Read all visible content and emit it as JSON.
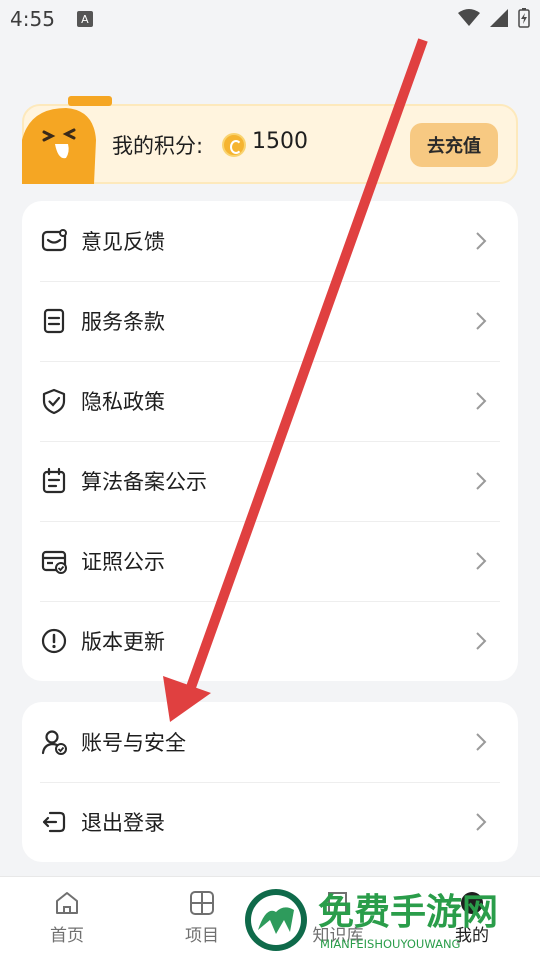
{
  "status_bar": {
    "time": "4:55",
    "notification_icon": "a-icon"
  },
  "points_card": {
    "label": "我的积分:",
    "value": "1500",
    "recharge_button": "去充值"
  },
  "menu_group_1": [
    {
      "label": "意见反馈",
      "icon": "feedback-icon"
    },
    {
      "label": "服务条款",
      "icon": "document-icon"
    },
    {
      "label": "隐私政策",
      "icon": "shield-icon"
    },
    {
      "label": "算法备案公示",
      "icon": "calendar-icon"
    },
    {
      "label": "证照公示",
      "icon": "license-card-icon"
    },
    {
      "label": "版本更新",
      "icon": "info-icon"
    }
  ],
  "menu_group_2": [
    {
      "label": "账号与安全",
      "icon": "user-shield-icon"
    },
    {
      "label": "退出登录",
      "icon": "logout-icon"
    }
  ],
  "tabbar": {
    "tabs": [
      {
        "label": "首页",
        "icon": "home-icon"
      },
      {
        "label": "项目",
        "icon": "grid-icon"
      },
      {
        "label": "知识库",
        "icon": "book-icon"
      },
      {
        "label": "我的",
        "icon": "profile-icon"
      }
    ]
  },
  "watermark": {
    "title": "免费手游网",
    "subtitle": "MIANFEISHOUYOUWANG"
  },
  "colors": {
    "accent_orange": "#f7c982",
    "annotation_arrow": "#e04040",
    "mascot": "#f5a623"
  }
}
